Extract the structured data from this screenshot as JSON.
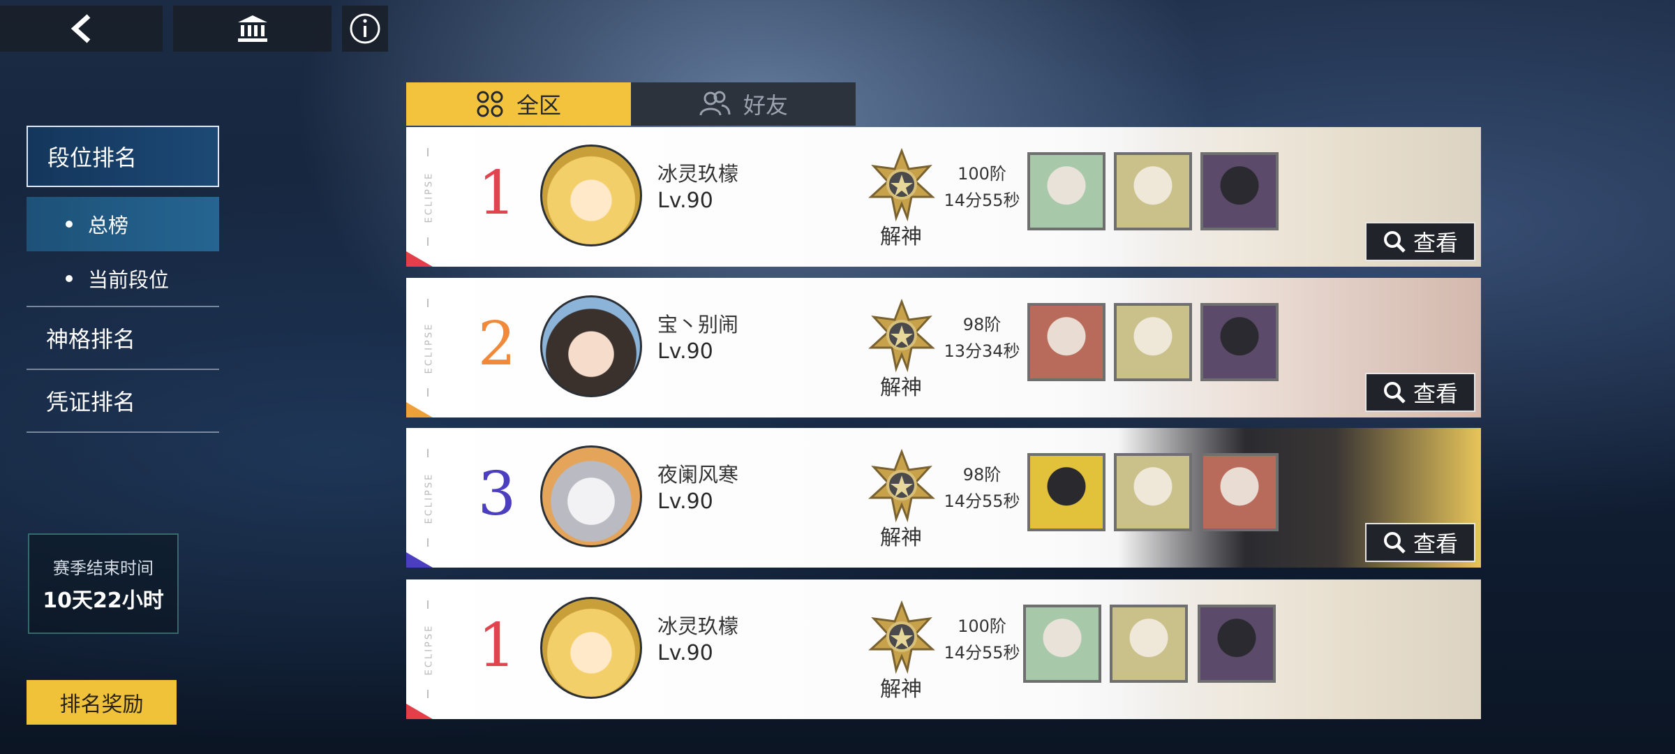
{
  "topbar": {
    "back_icon": "chevron-left-icon",
    "home_icon": "bank-icon",
    "info_icon": "info-icon"
  },
  "sidebar": {
    "items": [
      {
        "label": "段位排名",
        "active": true
      },
      {
        "label": "总榜",
        "active": true,
        "sub": true
      },
      {
        "label": "当前段位",
        "active": false,
        "sub": true
      },
      {
        "label": "神格排名",
        "active": false
      },
      {
        "label": "凭证排名",
        "active": false
      }
    ],
    "season_label": "赛季结束时间",
    "season_value": "10天22小时",
    "reward_button": "排名奖励"
  },
  "tabs": [
    {
      "label": "全区",
      "active": true
    },
    {
      "label": "好友",
      "active": false
    }
  ],
  "rows": [
    {
      "rank": "1",
      "rank_color": "#e0454f",
      "name": "冰灵玖檬",
      "level": "Lv.90",
      "tier": "解神",
      "stage": "100阶",
      "time": "14分55秒",
      "view": "查看",
      "eclipse": "ECLIPSE",
      "corner_color": "#e23f4b"
    },
    {
      "rank": "2",
      "rank_color": "#f08a3a",
      "name": "宝丶别闹",
      "level": "Lv.90",
      "tier": "解神",
      "stage": "98阶",
      "time": "13分34秒",
      "view": "查看",
      "eclipse": "ECLIPSE",
      "corner_color": "#f0a03a"
    },
    {
      "rank": "3",
      "rank_color": "#4b3fbf",
      "name": "夜阑风寒",
      "level": "Lv.90",
      "tier": "解神",
      "stage": "98阶",
      "time": "14分55秒",
      "view": "查看",
      "eclipse": "ECLIPSE",
      "corner_color": "#4b3fbf"
    },
    {
      "rank": "1",
      "rank_color": "#e0454f",
      "name": "冰灵玖檬",
      "level": "Lv.90",
      "tier": "解神",
      "stage": "100阶",
      "time": "14分55秒",
      "eclipse": "ECLIPSE",
      "corner_color": "#e23f4b"
    }
  ],
  "colors": {
    "accent": "#f3c33e",
    "nav_active": "#1c4975"
  }
}
